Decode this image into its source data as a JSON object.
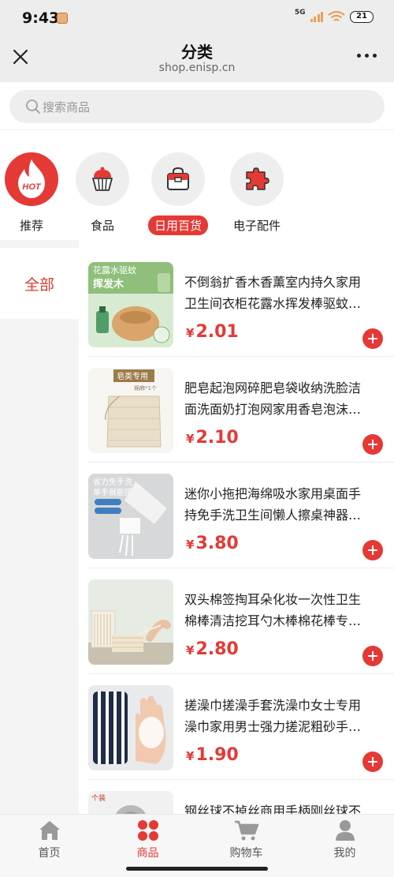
{
  "status_bar": {
    "time": "9:43",
    "signal": "5G",
    "battery": "21"
  },
  "nav": {
    "title": "分类",
    "subtitle": "shop.enisp.cn"
  },
  "search": {
    "placeholder": "搜索商品"
  },
  "categories": [
    {
      "label": "推荐",
      "badge": "HOT",
      "icon": "hot-flame-icon"
    },
    {
      "label": "食品",
      "icon": "cupcake-icon"
    },
    {
      "label": "日用百货",
      "icon": "bag-icon",
      "active": true
    },
    {
      "label": "电子配件",
      "icon": "puzzle-icon"
    }
  ],
  "sidebar": {
    "items": [
      {
        "label": "全部",
        "active": true
      }
    ]
  },
  "products": [
    {
      "line1": "不倒翁扩香木香薰室内持久家用",
      "line2": "卫生间衣柜花露水挥发棒驱蚊…",
      "currency": "¥",
      "price": "2.01",
      "thumb_text1": "花露水驱蚊",
      "thumb_text2": "挥发木"
    },
    {
      "line1": "肥皂起泡网碎肥皂袋收纳洗脸洁",
      "line2": "面洗面奶打泡网家用香皂泡沫…",
      "currency": "¥",
      "price": "2.10",
      "thumb_text1": "皂类专用",
      "thumb_text2": "棉麻*1个"
    },
    {
      "line1": "迷你小拖把海绵吸水家用桌面手",
      "line2": "持免手洗卫生间懒人擦桌神器…",
      "currency": "¥",
      "price": "3.80",
      "thumb_text1": "省力免手洗",
      "thumb_text2": "单手就能挤水"
    },
    {
      "line1": "双头棉签掏耳朵化妆一次性卫生",
      "line2": "棉棒清洁挖耳勺木棒棉花棒专…",
      "currency": "¥",
      "price": "2.80"
    },
    {
      "line1": "搓澡巾搓澡手套洗澡巾女士专用",
      "line2": "澡巾家用男士强力搓泥粗砂手…",
      "currency": "¥",
      "price": "1.90"
    },
    {
      "line1": "钢丝球不掉丝商用手柄刚丝球不",
      "line2": "",
      "currency": "¥",
      "price": "",
      "thumb_text1": "个装"
    }
  ],
  "tabs": [
    {
      "label": "首页",
      "icon": "home-icon"
    },
    {
      "label": "商品",
      "icon": "grid-icon",
      "active": true
    },
    {
      "label": "购物车",
      "icon": "cart-icon"
    },
    {
      "label": "我的",
      "icon": "user-icon"
    }
  ],
  "colors": {
    "accent": "#e53935",
    "sidebar_active_text": "#d43c2c"
  }
}
